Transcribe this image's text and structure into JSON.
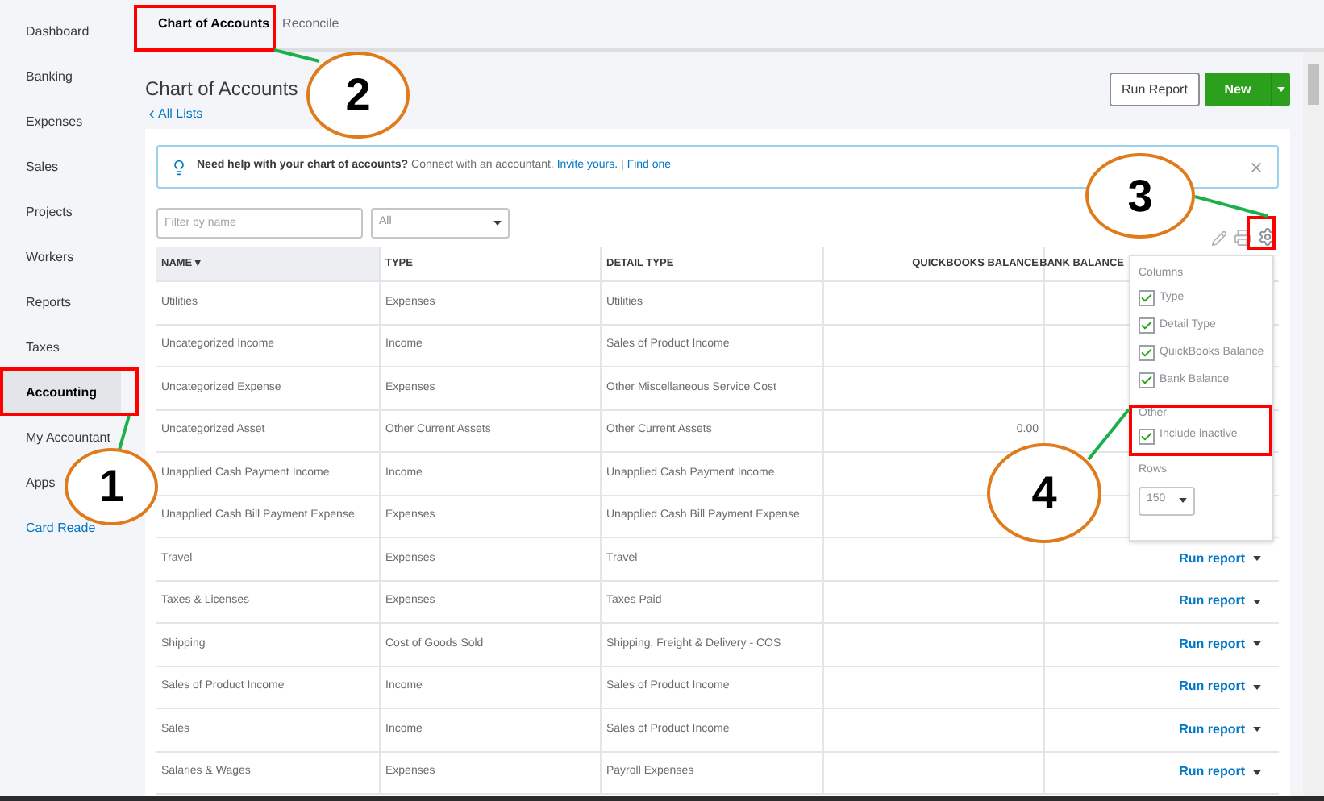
{
  "sidebar": {
    "items": [
      {
        "label": "Dashboard",
        "selected": false
      },
      {
        "label": "Banking",
        "selected": false
      },
      {
        "label": "Expenses",
        "selected": false
      },
      {
        "label": "Sales",
        "selected": false
      },
      {
        "label": "Projects",
        "selected": false
      },
      {
        "label": "Workers",
        "selected": false
      },
      {
        "label": "Reports",
        "selected": false
      },
      {
        "label": "Taxes",
        "selected": false
      },
      {
        "label": "Accounting",
        "selected": true
      },
      {
        "label": "My Accountant",
        "selected": false
      },
      {
        "label": "Apps",
        "selected": false
      }
    ],
    "link": "Card Reade"
  },
  "tabs": [
    {
      "label": "Chart of Accounts",
      "selected": true
    },
    {
      "label": "Reconcile",
      "selected": false
    }
  ],
  "page": {
    "title": "Chart of Accounts",
    "back_link": "All Lists",
    "buttons": {
      "run_report": "Run Report",
      "new": "New"
    }
  },
  "banner": {
    "bold": "Need help with your chart of accounts?",
    "text": "Connect with an accountant.",
    "link_1": "Invite yours.",
    "separator": "|",
    "link_2": "Find one"
  },
  "filter": {
    "placeholder": "Filter by name",
    "select": "All"
  },
  "table": {
    "columns": [
      "NAME ▾",
      "TYPE",
      "DETAIL TYPE",
      "QUICKBOOKS BALANCE",
      "BANK BALANCE"
    ],
    "rows": [
      {
        "name": "Utilities",
        "type": "Expenses",
        "detail": "Utilities"
      },
      {
        "name": "Uncategorized Income",
        "type": "Income",
        "detail": "Sales of Product Income"
      },
      {
        "name": "Uncategorized Expense",
        "type": "Expenses",
        "detail": "Other Miscellaneous Service Cost"
      },
      {
        "name": "Uncategorized Asset",
        "type": "Other Current Assets",
        "detail": "Other Current Assets",
        "qb_balance": "0.00"
      },
      {
        "name": "Unapplied Cash Payment Income",
        "type": "Income",
        "detail": "Unapplied Cash Payment Income"
      },
      {
        "name": "Unapplied Cash Bill Payment Expense",
        "type": "Expenses",
        "detail": "Unapplied Cash Bill Payment Expense"
      },
      {
        "name": "Travel",
        "type": "Expenses",
        "detail": "Travel",
        "action": "Run report"
      },
      {
        "name": "Taxes & Licenses",
        "type": "Expenses",
        "detail": "Taxes Paid",
        "action": "Run report"
      },
      {
        "name": "Shipping",
        "type": "Cost of Goods Sold",
        "detail": "Shipping, Freight & Delivery - COS",
        "action": "Run report"
      },
      {
        "name": "Sales of Product Income",
        "type": "Income",
        "detail": "Sales of Product Income",
        "action": "Run report"
      },
      {
        "name": "Sales",
        "type": "Income",
        "detail": "Sales of Product Income",
        "action": "Run report"
      },
      {
        "name": "Salaries & Wages",
        "type": "Expenses",
        "detail": "Payroll Expenses",
        "action": "Run report"
      }
    ]
  },
  "settings_menu": {
    "columns_label": "Columns",
    "columns": [
      {
        "label": "Type",
        "checked": true
      },
      {
        "label": "Detail Type",
        "checked": true
      },
      {
        "label": "QuickBooks Balance",
        "checked": true
      },
      {
        "label": "Bank Balance",
        "checked": true
      }
    ],
    "other_label": "Other",
    "other": [
      {
        "label": "Include inactive",
        "checked": true
      }
    ],
    "rows_label": "Rows",
    "rows_value": "150"
  },
  "annotations": [
    {
      "label": "1"
    },
    {
      "label": "2"
    },
    {
      "label": "3"
    },
    {
      "label": "4"
    }
  ]
}
